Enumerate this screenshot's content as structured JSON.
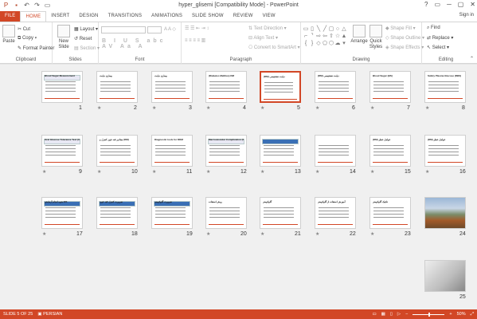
{
  "window": {
    "title": "hyper_glisemi [Compatibility Mode] - PowerPoint",
    "controls": [
      "?",
      "▭",
      "─",
      "▢",
      "✕"
    ]
  },
  "tabs": [
    "FILE",
    "HOME",
    "INSERT",
    "DESIGN",
    "TRANSITIONS",
    "ANIMATIONS",
    "SLIDE SHOW",
    "REVIEW",
    "VIEW"
  ],
  "signin": "Sign in",
  "ribbon": {
    "clipboard": {
      "label": "Clipboard",
      "paste": "Paste",
      "cut": "Cut",
      "copy": "Copy",
      "format_painter": "Format Painter"
    },
    "slides": {
      "label": "Slides",
      "new_slide": "New Slide",
      "layout": "Layout",
      "reset": "Reset",
      "section": "Section"
    },
    "font": {
      "label": "Font"
    },
    "paragraph": {
      "label": "Paragraph",
      "text_direction": "Text Direction",
      "align_text": "Align Text",
      "convert": "Convert to SmartArt"
    },
    "drawing": {
      "label": "Drawing",
      "arrange": "Arrange",
      "quick_styles": "Quick Styles",
      "shape_fill": "Shape Fill",
      "shape_outline": "Shape Outline",
      "shape_effects": "Shape Effects"
    },
    "editing": {
      "label": "Editing",
      "find": "Find",
      "replace": "Replace",
      "select": "Select"
    }
  },
  "slides": [
    {
      "n": "8",
      "title": "Safety Plasma Glucose (RBS)",
      "star": "★"
    },
    {
      "n": "7",
      "title": "Blood Sugar (BS)",
      "star": "★"
    },
    {
      "n": "6",
      "title": "(DM) دیابت تشخیصی",
      "star": "★"
    },
    {
      "n": "5",
      "title": "(DM) دیابت تشخیصی",
      "star": "★"
    },
    {
      "n": "4",
      "title": "(Diabetes Mellitus) DM",
      "star": "★"
    },
    {
      "n": "3",
      "title": "بیماری دیابت",
      "star": "★"
    },
    {
      "n": "2",
      "title": "بیماری دیابت",
      "star": "★"
    },
    {
      "n": "1",
      "title": "Blood Sugar Measurement",
      "star": ""
    },
    {
      "n": "16",
      "title": "(DM) عوامل خطر",
      "star": "★"
    },
    {
      "n": "15",
      "title": "(DM) عوامل خطر",
      "star": "★"
    },
    {
      "n": "14",
      "title": "",
      "star": "★"
    },
    {
      "n": "13",
      "title": "",
      "star": "★"
    },
    {
      "n": "12",
      "title": "Macrovascular Complication (DM)",
      "star": "★"
    },
    {
      "n": "11",
      "title": "Diagnostic tools for DDM",
      "star": "★"
    },
    {
      "n": "10",
      "title": "مقادیر قند خون کنترل و (DM)",
      "star": "★"
    },
    {
      "n": "9",
      "title": "Oral Glucose Tolerance Test (OGTT)",
      "star": "★"
    },
    {
      "n": "24",
      "title": "",
      "star": ""
    },
    {
      "n": "23",
      "title": "تکنیک گلوکومتر",
      "star": "★"
    },
    {
      "n": "22",
      "title": "آموزش استفاده از گلوکومتر",
      "star": "★"
    },
    {
      "n": "21",
      "title": "گلوکومتر",
      "star": "★"
    },
    {
      "n": "20",
      "title": "روش استفاده",
      "star": "★"
    },
    {
      "n": "19",
      "title": "ضرورت گلوکومتر",
      "star": ""
    },
    {
      "n": "18",
      "title": "ضرورت کنترل قند خون",
      "star": ""
    },
    {
      "n": "17",
      "title": "نحوه انجام آزمایش BS",
      "star": "★"
    },
    {
      "n": "25",
      "title": "",
      "star": ""
    }
  ],
  "status": {
    "slide": "SLIDE 5 OF 25",
    "language": "PERSIAN",
    "zoom": "50%"
  }
}
